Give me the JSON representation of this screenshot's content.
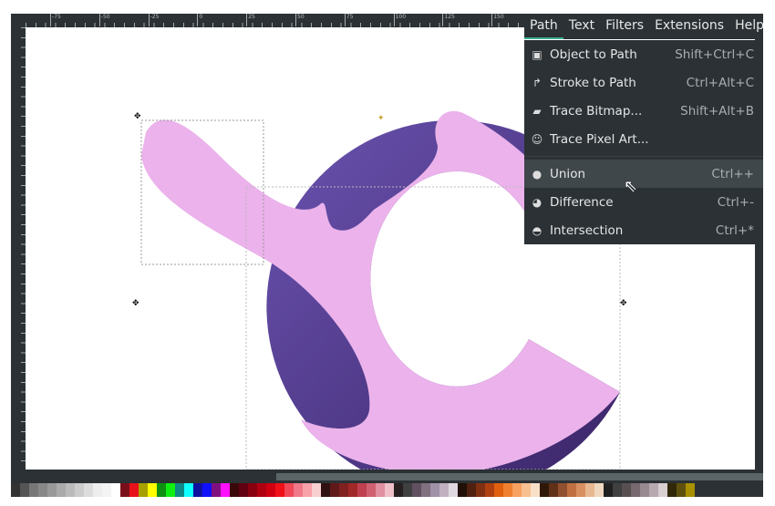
{
  "menubar": {
    "items": [
      "Path",
      "Text",
      "Filters",
      "Extensions",
      "Help"
    ],
    "active": "Path"
  },
  "path_menu": {
    "items": [
      {
        "label": "Object to Path",
        "shortcut": "Shift+Ctrl+C",
        "icon": "object-to-path-icon"
      },
      {
        "label": "Stroke to Path",
        "shortcut": "Ctrl+Alt+C",
        "icon": "stroke-to-path-icon"
      },
      {
        "label": "Trace Bitmap...",
        "shortcut": "Shift+Alt+B",
        "icon": "trace-bitmap-icon"
      },
      {
        "label": "Trace Pixel Art...",
        "shortcut": "",
        "icon": "trace-pixel-art-icon"
      },
      {
        "label": "Union",
        "shortcut": "Ctrl++",
        "icon": "union-icon",
        "highlighted": true
      },
      {
        "label": "Difference",
        "shortcut": "Ctrl+-",
        "icon": "difference-icon"
      },
      {
        "label": "Intersection",
        "shortcut": "Ctrl+*",
        "icon": "intersection-icon"
      }
    ]
  },
  "ruler": {
    "labels": [
      "-75",
      "-50",
      "-25",
      "0",
      "25",
      "50",
      "75",
      "100",
      "125",
      "150"
    ]
  },
  "colors": {
    "accent": "#3daf8f",
    "purple": "#5a3f99",
    "pink": "#ebb2eb"
  },
  "palette": [
    "#333",
    "#555",
    "#777",
    "#888",
    "#999",
    "#aaa",
    "#bbb",
    "#ccc",
    "#ddd",
    "#eee",
    "#f4f4f4",
    "#fff",
    "#7a0f1a",
    "#e8101a",
    "#a8a000",
    "#ffff00",
    "#109010",
    "#10f010",
    "#108888",
    "#10ffff",
    "#1010a0",
    "#1010ff",
    "#801080",
    "#ff10ff",
    "#3a0808",
    "#600010",
    "#880010",
    "#b00010",
    "#d00010",
    "#f01018",
    "#f04858",
    "#f07888",
    "#f8a0a8",
    "#f8d0d0",
    "#301010",
    "#601818",
    "#802020",
    "#a02828",
    "#c04050",
    "#d06070",
    "#e090a0",
    "#f0c0c8",
    "#282020",
    "#404040",
    "#605060",
    "#807080",
    "#a090a8",
    "#c0b0c0",
    "#e0d8e0",
    "#201008",
    "#502010",
    "#803010",
    "#b04010",
    "#e06010",
    "#f08030",
    "#f8a060",
    "#f8c090",
    "#f8e0c8",
    "#301808",
    "#603018",
    "#905030",
    "#c07040",
    "#d89060",
    "#e8b890",
    "#f0d8c0",
    "#202020",
    "#404040",
    "#585050",
    "#786870",
    "#988890",
    "#b8a8b0",
    "#d8d0d0",
    "#302808",
    "#605010",
    "#a89000"
  ]
}
